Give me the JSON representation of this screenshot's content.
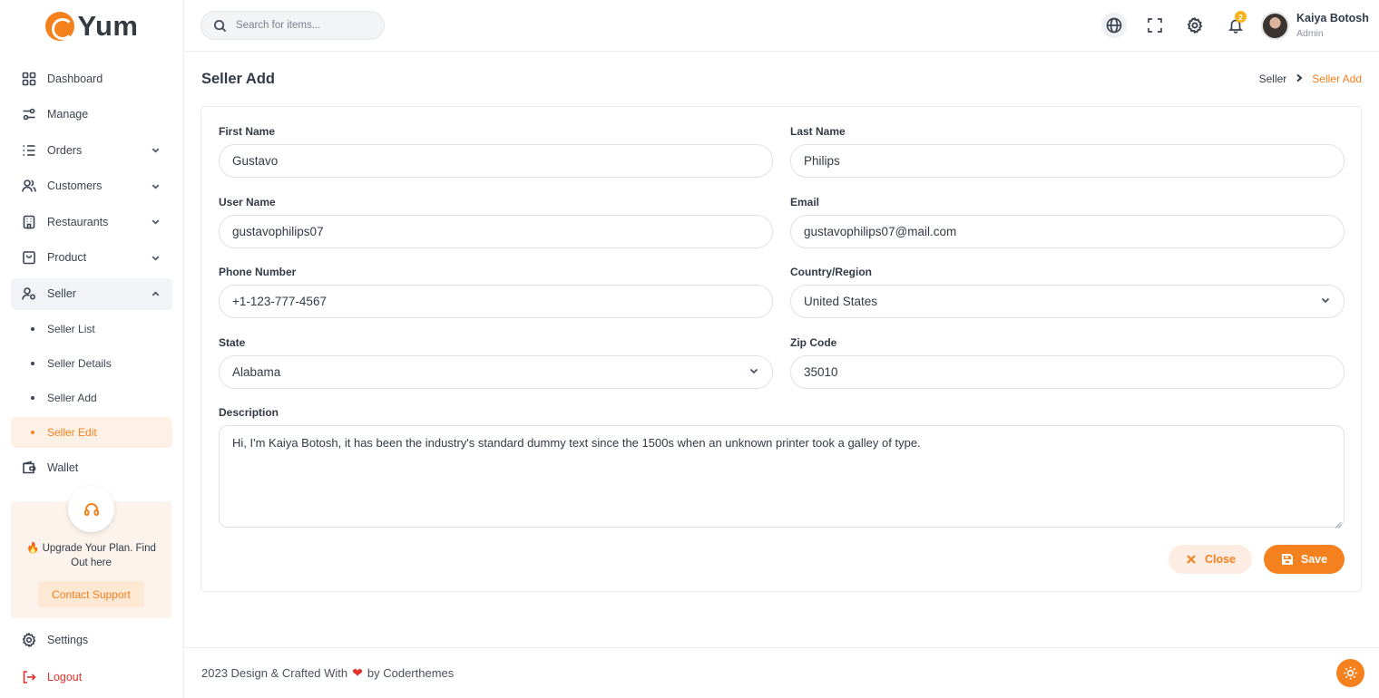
{
  "brand": {
    "name": "Yum",
    "accent": "#f5801e"
  },
  "sidebar": {
    "items": [
      {
        "label": "Dashboard",
        "icon": "grid-icon"
      },
      {
        "label": "Manage",
        "icon": "sliders-icon"
      },
      {
        "label": "Orders",
        "icon": "list-icon"
      },
      {
        "label": "Customers",
        "icon": "users-icon"
      },
      {
        "label": "Restaurants",
        "icon": "building-icon"
      },
      {
        "label": "Product",
        "icon": "shopping-bag-icon"
      },
      {
        "label": "Seller",
        "icon": "user-cog-icon"
      }
    ],
    "seller_sub": [
      {
        "label": "Seller List"
      },
      {
        "label": "Seller Details"
      },
      {
        "label": "Seller Add"
      },
      {
        "label": "Seller Edit"
      }
    ],
    "wallet": "Wallet",
    "upgrade": {
      "text": "🔥 Upgrade Your Plan. Find Out here",
      "button": "Contact Support"
    },
    "settings": "Settings",
    "logout": "Logout"
  },
  "topbar": {
    "search_placeholder": "Search for items...",
    "notification_count": "2",
    "user": {
      "name": "Kaiya Botosh",
      "role": "Admin"
    }
  },
  "page": {
    "title": "Seller Add",
    "breadcrumb": {
      "parent": "Seller",
      "current": "Seller Add"
    }
  },
  "form": {
    "first_name": {
      "label": "First Name",
      "value": "Gustavo"
    },
    "last_name": {
      "label": "Last Name",
      "value": "Philips"
    },
    "user_name": {
      "label": "User Name",
      "value": "gustavophilips07"
    },
    "email": {
      "label": "Email",
      "value": "gustavophilips07@mail.com"
    },
    "phone": {
      "label": "Phone Number",
      "value": "+1-123-777-4567"
    },
    "country": {
      "label": "Country/Region",
      "value": "United States"
    },
    "state": {
      "label": "State",
      "value": "Alabama"
    },
    "zip": {
      "label": "Zip Code",
      "value": "35010"
    },
    "description": {
      "label": "Description",
      "value": "Hi, I'm Kaiya Botosh, it has been the industry's standard dummy text since the 1500s when an unknown printer took a galley of type."
    },
    "close_label": "Close",
    "save_label": "Save"
  },
  "footer": {
    "prefix": "2023 Design & Crafted With",
    "suffix": "by Coderthemes"
  }
}
